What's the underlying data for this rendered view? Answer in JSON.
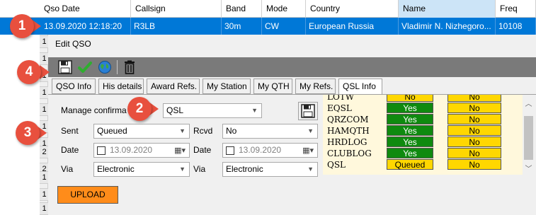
{
  "grid": {
    "columns": [
      "Qso Date",
      "Callsign",
      "Band",
      "Mode",
      "Country",
      "Name",
      "Freq"
    ],
    "selected_row": [
      "13.09.2020 12:18:20",
      "R3LB",
      "30m",
      "CW",
      "European Russia",
      "Vladimir N. Nizhegoro...",
      "10108"
    ],
    "row_stubs": [
      "1",
      "1",
      "1",
      "1",
      "1",
      "1",
      "1",
      "2",
      "2",
      "1",
      "1",
      "1"
    ]
  },
  "edit_panel": {
    "title": "Edit QSO",
    "tabs": [
      "QSO Info",
      "His details",
      "Award Refs.",
      "My Station",
      "My QTH",
      "My Refs.",
      "QSL Info"
    ],
    "active_tab": "QSL Info",
    "manage_label": "Manage confirma",
    "manage_value": "QSL",
    "sent_label": "Sent",
    "sent_value": "Queued",
    "rcvd_label": "Rcvd",
    "rcvd_value": "No",
    "date_label": "Date",
    "sent_date": "13.09.2020",
    "rcvd_date_label": "Date",
    "rcvd_date": "13.09.2020",
    "via_label": "Via",
    "sent_via": "Electronic",
    "rcvd_via_label": "Via",
    "rcvd_via": "Electronic",
    "upload_label": "UPLOAD"
  },
  "status_list": [
    {
      "name": "LOTW",
      "sent": "No",
      "rcvd": "No",
      "sent_color": "#ffd700",
      "rcvd_color": "#ffd700"
    },
    {
      "name": "EQSL",
      "sent": "Yes",
      "rcvd": "No",
      "sent_color": "#0f8a0f",
      "rcvd_color": "#ffd700"
    },
    {
      "name": "QRZCOM",
      "sent": "Yes",
      "rcvd": "No",
      "sent_color": "#0f8a0f",
      "rcvd_color": "#ffd700"
    },
    {
      "name": "HAMQTH",
      "sent": "Yes",
      "rcvd": "No",
      "sent_color": "#0f8a0f",
      "rcvd_color": "#ffd700"
    },
    {
      "name": "HRDLOG",
      "sent": "Yes",
      "rcvd": "No",
      "sent_color": "#0f8a0f",
      "rcvd_color": "#ffd700"
    },
    {
      "name": "CLUBLOG",
      "sent": "Yes",
      "rcvd": "No",
      "sent_color": "#0f8a0f",
      "rcvd_color": "#ffd700"
    },
    {
      "name": "QSL",
      "sent": "Queued",
      "rcvd": "No",
      "sent_color": "#ffd700",
      "rcvd_color": "#ffd700"
    }
  ],
  "callouts": [
    "1",
    "2",
    "3",
    "4"
  ],
  "colors": {
    "selection": "#0078d7",
    "toolbar": "#7a7a7a",
    "upload": "#ff8c1a",
    "callout": "#e8503e",
    "status_bg": "#fff8dc"
  }
}
